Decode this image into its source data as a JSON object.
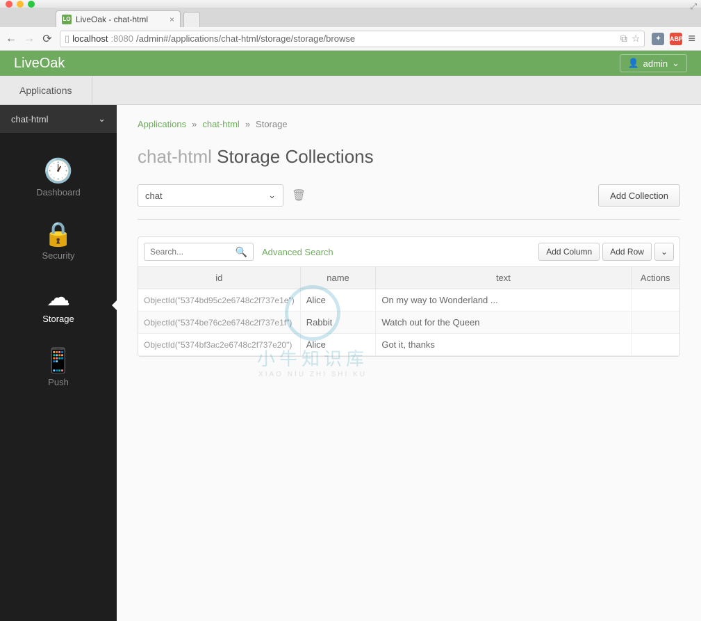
{
  "browser": {
    "tab_title": "LiveOak - chat-html",
    "favicon_text": "LO",
    "url_host": "localhost",
    "url_port": ":8080",
    "url_path": "/admin#/applications/chat-html/storage/storage/browse"
  },
  "header": {
    "brand": "LiveOak",
    "user": "admin",
    "subnav": "Applications"
  },
  "sidebar": {
    "context": "chat-html",
    "items": [
      {
        "label": "Dashboard"
      },
      {
        "label": "Security"
      },
      {
        "label": "Storage"
      },
      {
        "label": "Push"
      }
    ]
  },
  "breadcrumb": {
    "a": "Applications",
    "b": "chat-html",
    "c": "Storage"
  },
  "page": {
    "ctx": "chat-html",
    "title": "Storage Collections",
    "collection_selected": "chat",
    "add_collection": "Add Collection"
  },
  "tabletools": {
    "search_placeholder": "Search...",
    "advanced": "Advanced Search",
    "add_column": "Add Column",
    "add_row": "Add Row"
  },
  "table": {
    "columns": {
      "id": "id",
      "name": "name",
      "text": "text",
      "actions": "Actions"
    },
    "rows": [
      {
        "id": "ObjectId(\"5374bd95c2e6748c2f737e1e\")",
        "name": "Alice",
        "text": "On my way to Wonderland ..."
      },
      {
        "id": "ObjectId(\"5374be76c2e6748c2f737e1f\")",
        "name": "Rabbit",
        "text": "Watch out for the Queen"
      },
      {
        "id": "ObjectId(\"5374bf3ac2e6748c2f737e20\")",
        "name": "Alice",
        "text": "Got it, thanks"
      }
    ]
  },
  "watermark": {
    "big": "小牛知识库",
    "sm": "XIAO NIU ZHI SHI KU"
  }
}
